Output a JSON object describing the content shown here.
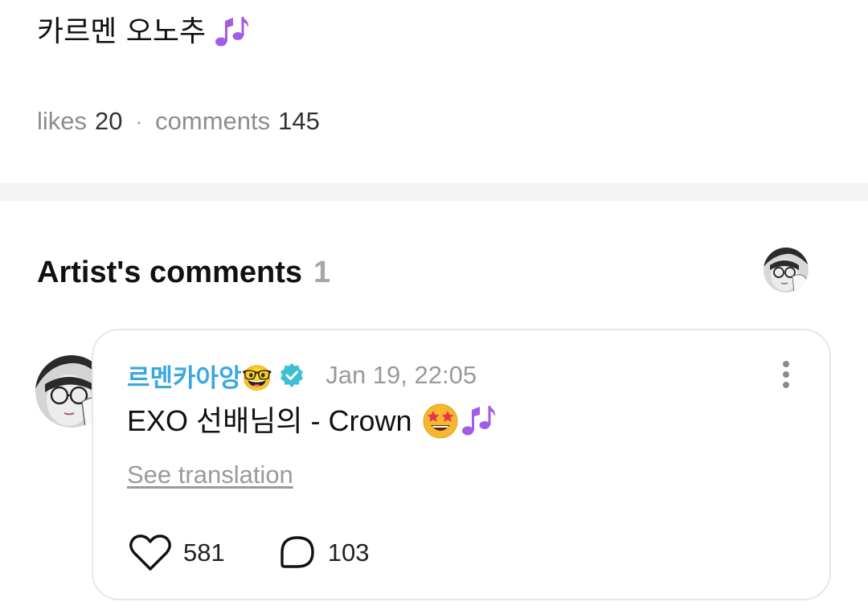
{
  "post": {
    "title": "카르멘 오노추",
    "title_emoji": "music-notes-icon"
  },
  "stats": {
    "likes_label": "likes",
    "likes_count": "20",
    "separator": "·",
    "comments_label": "comments",
    "comments_count": "145"
  },
  "artist_comments": {
    "title": "Artist's comments",
    "count": "1",
    "comment": {
      "author": "르멘카아앙🤓",
      "verified": true,
      "date": "Jan 19, 22:05",
      "text": "EXO 선배님의 - Crown",
      "text_emojis": [
        "star-struck-emoji",
        "music-notes-icon"
      ],
      "see_translation": "See translation",
      "likes": "581",
      "replies": "103"
    }
  },
  "colors": {
    "author": "#3aa8e0",
    "verified_badge": "#3bbfd4",
    "muted_text": "#9a9a9a",
    "divider_band": "#f3f3f3",
    "card_border": "#e6e6e6",
    "music_notes": "#a55be6"
  }
}
